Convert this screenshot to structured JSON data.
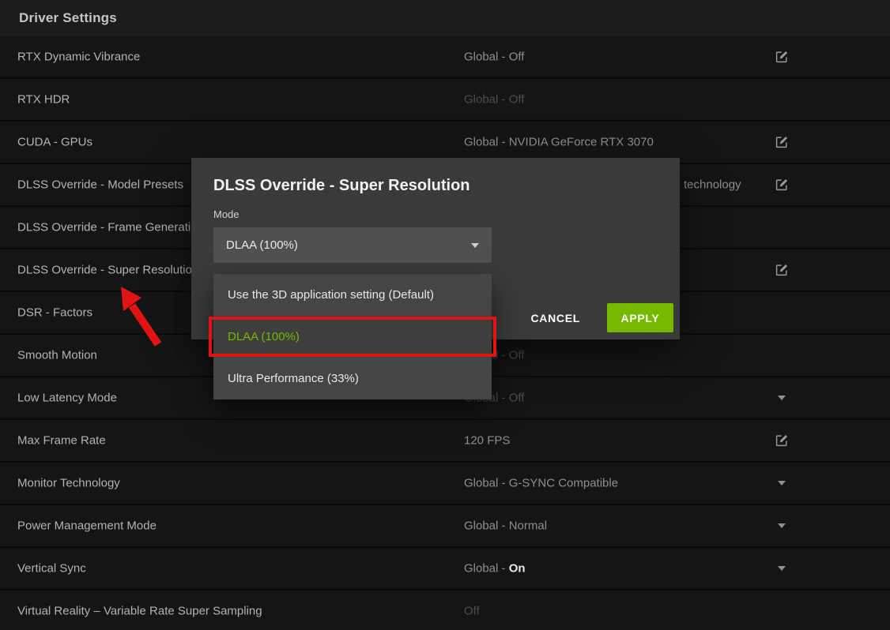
{
  "page": {
    "title": "Driver Settings"
  },
  "colors": {
    "accent_green": "#76b900",
    "annotation_red": "#e01414"
  },
  "rows": [
    {
      "label": "RTX Dynamic Vibrance",
      "value": "Global - Off",
      "dimmed": false,
      "control": "edit"
    },
    {
      "label": "RTX HDR",
      "value": "Global - Off",
      "dimmed": true,
      "control": "none"
    },
    {
      "label": "CUDA - GPUs",
      "value": "Global - NVIDIA GeForce RTX 3070",
      "dimmed": false,
      "control": "edit"
    },
    {
      "label": "DLSS Override - Model Presets",
      "value": "",
      "value_fragment": "technology",
      "dimmed": false,
      "control": "edit"
    },
    {
      "label": "DLSS Override - Frame Generation",
      "value": "",
      "dimmed": false,
      "control": "none"
    },
    {
      "label": "DLSS Override - Super Resolution",
      "value": "",
      "dimmed": false,
      "control": "edit"
    },
    {
      "label": "DSR - Factors",
      "value": "",
      "dimmed": false,
      "control": "none"
    },
    {
      "label": "Smooth Motion",
      "value": "Global - Off",
      "dimmed": true,
      "control": "none"
    },
    {
      "label": "Low Latency Mode",
      "value": "Global - Off",
      "dimmed": true,
      "control": "chevron"
    },
    {
      "label": "Max Frame Rate",
      "value": "120 FPS",
      "dimmed": false,
      "control": "edit"
    },
    {
      "label": "Monitor Technology",
      "value": "Global - G-SYNC Compatible",
      "dimmed": false,
      "control": "chevron"
    },
    {
      "label": "Power Management Mode",
      "value": "Global - Normal",
      "dimmed": false,
      "control": "chevron"
    },
    {
      "label": "Vertical Sync",
      "value": "Global - ",
      "value_strong": "On",
      "dimmed": false,
      "control": "chevron"
    },
    {
      "label": "Virtual Reality – Variable Rate Super Sampling",
      "value": "Off",
      "dimmed": true,
      "control": "none"
    }
  ],
  "modal": {
    "title": "DLSS Override - Super Resolution",
    "field_label": "Mode",
    "dropdown_value": "DLAA (100%)",
    "options": [
      {
        "label": "Use the 3D application setting (Default)",
        "selected": false
      },
      {
        "label": "DLAA (100%)",
        "selected": true,
        "annotated": true
      },
      {
        "label": "Ultra Performance (33%)",
        "selected": false
      }
    ],
    "cancel_label": "CANCEL",
    "apply_label": "APPLY"
  }
}
